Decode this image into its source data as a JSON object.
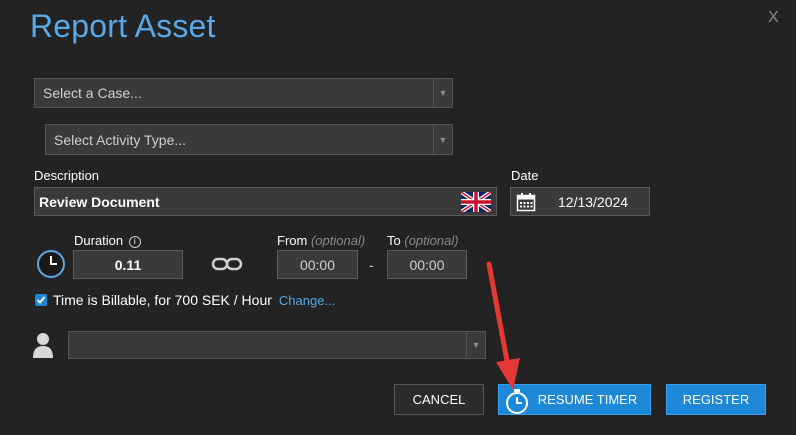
{
  "dialog": {
    "title": "Report Asset",
    "close_label": "X"
  },
  "case_select": {
    "value": "Select a Case..."
  },
  "activity_select": {
    "value": "Select Activity Type..."
  },
  "description": {
    "label": "Description",
    "value": "Review Document",
    "flag_icon": "uk-flag-icon"
  },
  "date": {
    "label": "Date",
    "value": "12/13/2024",
    "icon": "calendar-icon"
  },
  "duration": {
    "label": "Duration",
    "info_icon": "info-icon",
    "value": "0.11",
    "clock_icon": "clock-icon",
    "link_icon": "chain-link-icon"
  },
  "from": {
    "label": "From",
    "optional": "(optional)",
    "value": "00:00"
  },
  "separator": "-",
  "to": {
    "label": "To",
    "optional": "(optional)",
    "value": "00:00"
  },
  "billable": {
    "checked": true,
    "text": "Time is Billable, for 700 SEK / Hour",
    "change_link": "Change..."
  },
  "user_select": {
    "value": "",
    "icon": "user-icon"
  },
  "buttons": {
    "cancel": "CANCEL",
    "resume_timer": "RESUME TIMER",
    "resume_timer_icon": "stopwatch-icon",
    "register": "REGISTER"
  },
  "colors": {
    "background": "#232323",
    "accent": "#5aa8e6",
    "button_blue": "#1e88d8",
    "annotation_arrow": "#e53935"
  }
}
